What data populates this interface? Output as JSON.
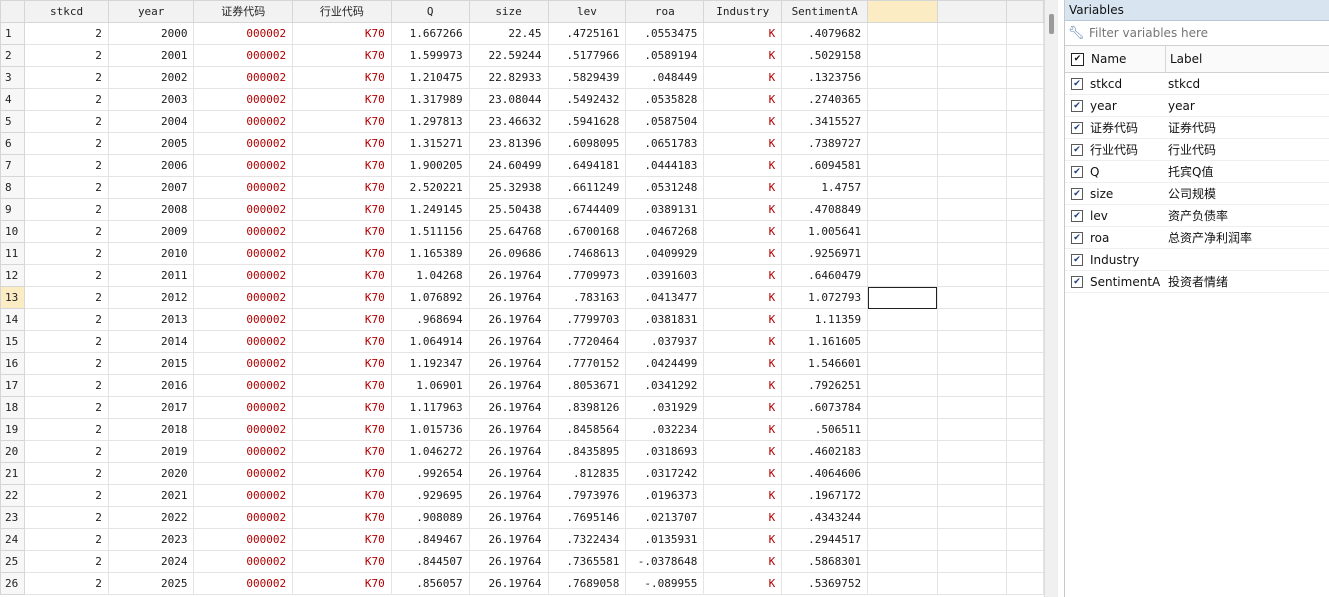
{
  "grid": {
    "columns": [
      "stkcd",
      "year",
      "证券代码",
      "行业代码",
      "Q",
      "size",
      "lev",
      "roa",
      "Industry",
      "SentimentA"
    ],
    "col_types": [
      "num",
      "num",
      "str",
      "str",
      "num",
      "num",
      "num",
      "num",
      "str",
      "num"
    ],
    "selected_row": 13,
    "rows": [
      [
        "2",
        "2000",
        "000002",
        "K70",
        "1.667266",
        "22.45",
        ".4725161",
        ".0553475",
        "K",
        ".4079682"
      ],
      [
        "2",
        "2001",
        "000002",
        "K70",
        "1.599973",
        "22.59244",
        ".5177966",
        ".0589194",
        "K",
        ".5029158"
      ],
      [
        "2",
        "2002",
        "000002",
        "K70",
        "1.210475",
        "22.82933",
        ".5829439",
        ".048449",
        "K",
        ".1323756"
      ],
      [
        "2",
        "2003",
        "000002",
        "K70",
        "1.317989",
        "23.08044",
        ".5492432",
        ".0535828",
        "K",
        ".2740365"
      ],
      [
        "2",
        "2004",
        "000002",
        "K70",
        "1.297813",
        "23.46632",
        ".5941628",
        ".0587504",
        "K",
        ".3415527"
      ],
      [
        "2",
        "2005",
        "000002",
        "K70",
        "1.315271",
        "23.81396",
        ".6098095",
        ".0651783",
        "K",
        ".7389727"
      ],
      [
        "2",
        "2006",
        "000002",
        "K70",
        "1.900205",
        "24.60499",
        ".6494181",
        ".0444183",
        "K",
        ".6094581"
      ],
      [
        "2",
        "2007",
        "000002",
        "K70",
        "2.520221",
        "25.32938",
        ".6611249",
        ".0531248",
        "K",
        "1.4757"
      ],
      [
        "2",
        "2008",
        "000002",
        "K70",
        "1.249145",
        "25.50438",
        ".6744409",
        ".0389131",
        "K",
        ".4708849"
      ],
      [
        "2",
        "2009",
        "000002",
        "K70",
        "1.511156",
        "25.64768",
        ".6700168",
        ".0467268",
        "K",
        "1.005641"
      ],
      [
        "2",
        "2010",
        "000002",
        "K70",
        "1.165389",
        "26.09686",
        ".7468613",
        ".0409929",
        "K",
        ".9256971"
      ],
      [
        "2",
        "2011",
        "000002",
        "K70",
        "1.04268",
        "26.19764",
        ".7709973",
        ".0391603",
        "K",
        ".6460479"
      ],
      [
        "2",
        "2012",
        "000002",
        "K70",
        "1.076892",
        "26.19764",
        ".783163",
        ".0413477",
        "K",
        "1.072793"
      ],
      [
        "2",
        "2013",
        "000002",
        "K70",
        ".968694",
        "26.19764",
        ".7799703",
        ".0381831",
        "K",
        "1.11359"
      ],
      [
        "2",
        "2014",
        "000002",
        "K70",
        "1.064914",
        "26.19764",
        ".7720464",
        ".037937",
        "K",
        "1.161605"
      ],
      [
        "2",
        "2015",
        "000002",
        "K70",
        "1.192347",
        "26.19764",
        ".7770152",
        ".0424499",
        "K",
        "1.546601"
      ],
      [
        "2",
        "2016",
        "000002",
        "K70",
        "1.06901",
        "26.19764",
        ".8053671",
        ".0341292",
        "K",
        ".7926251"
      ],
      [
        "2",
        "2017",
        "000002",
        "K70",
        "1.117963",
        "26.19764",
        ".8398126",
        ".031929",
        "K",
        ".6073784"
      ],
      [
        "2",
        "2018",
        "000002",
        "K70",
        "1.015736",
        "26.19764",
        ".8458564",
        ".032234",
        "K",
        ".506511"
      ],
      [
        "2",
        "2019",
        "000002",
        "K70",
        "1.046272",
        "26.19764",
        ".8435895",
        ".0318693",
        "K",
        ".4602183"
      ],
      [
        "2",
        "2020",
        "000002",
        "K70",
        ".992654",
        "26.19764",
        ".812835",
        ".0317242",
        "K",
        ".4064606"
      ],
      [
        "2",
        "2021",
        "000002",
        "K70",
        ".929695",
        "26.19764",
        ".7973976",
        ".0196373",
        "K",
        ".1967172"
      ],
      [
        "2",
        "2022",
        "000002",
        "K70",
        ".908089",
        "26.19764",
        ".7695146",
        ".0213707",
        "K",
        ".4343244"
      ],
      [
        "2",
        "2023",
        "000002",
        "K70",
        ".849467",
        "26.19764",
        ".7322434",
        ".0135931",
        "K",
        ".2944517"
      ],
      [
        "2",
        "2024",
        "000002",
        "K70",
        ".844507",
        "26.19764",
        ".7365581",
        "-.0378648",
        "K",
        ".5868301"
      ],
      [
        "2",
        "2025",
        "000002",
        "K70",
        ".856057",
        "26.19764",
        ".7689058",
        "-.089955",
        "K",
        ".5369752"
      ]
    ]
  },
  "variables_panel": {
    "title": "Variables",
    "filter_placeholder": "Filter variables here",
    "header_name": "Name",
    "header_label": "Label",
    "icons": {
      "filter": "wrench-icon",
      "checked": "checkmark-icon"
    },
    "variables": [
      {
        "name": "stkcd",
        "label": "stkcd"
      },
      {
        "name": "year",
        "label": "year"
      },
      {
        "name": "证券代码",
        "label": "证券代码"
      },
      {
        "name": "行业代码",
        "label": "行业代码"
      },
      {
        "name": "Q",
        "label": "托宾Q值"
      },
      {
        "name": "size",
        "label": "公司规模"
      },
      {
        "name": "lev",
        "label": "资产负债率"
      },
      {
        "name": "roa",
        "label": "总资产净利润率"
      },
      {
        "name": "Industry",
        "label": ""
      },
      {
        "name": "SentimentA",
        "label": "投资者情绪"
      }
    ]
  },
  "colors": {
    "string_value": "#b00000",
    "active_highlight": "#fbecc4",
    "panel_title_bg": "#d9e4f1"
  }
}
